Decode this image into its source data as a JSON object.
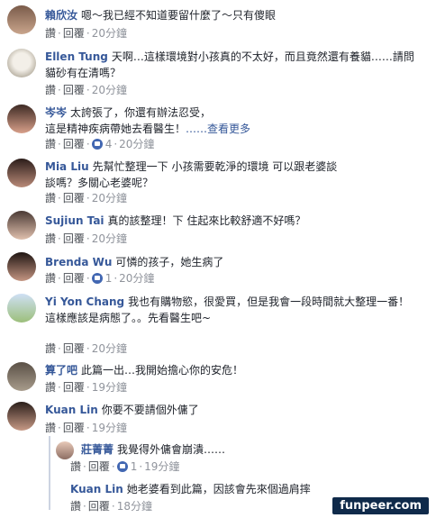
{
  "labels": {
    "reply_action": "讚",
    "reply_link": "回覆",
    "dot": "·"
  },
  "comments": [
    {
      "name": "賴欣汝",
      "text": "嗯～我已經不知道要留什麼了～只有傻眼",
      "time": "20分鐘"
    },
    {
      "name": "Ellen Tung",
      "text": "天啊…這樣環境對小孩真的不太好，而且竟然還有養貓……請問貓砂有在清嗎？",
      "time": "20分鐘"
    },
    {
      "name": "岑岑",
      "text": "太誇張了，你還有辦法忍受，",
      "text2": "這是精神疾病帶她去看醫生！",
      "more": "……查看更多",
      "likes": "4",
      "time": "20分鐘"
    },
    {
      "name": "Mia Liu",
      "text": "先幫忙整理一下 小孩需要乾淨的環境 可以跟老婆談談嗎？多關心老婆呢？",
      "time": "20分鐘"
    },
    {
      "name": "Sujiun Tai",
      "text": "真的該整理！下 住起來比較舒適不好嗎？",
      "time": "20分鐘"
    },
    {
      "name": "Brenda Wu",
      "text": "可憐的孩子，她生病了",
      "likes": "1",
      "time": "20分鐘"
    },
    {
      "name": "Yi Yon Chang",
      "text": "我也有購物慾，很愛買，但是我會一段時間就大整理一番！",
      "text2": "這樣應該是病態了。。先看醫生吧~",
      "time": "20分鐘"
    },
    {
      "name": "算了吧",
      "text": "此篇一出…我開始擔心你的安危！",
      "time": "19分鐘"
    },
    {
      "name": "Kuan Lin",
      "text": "你要不要請個外傭了",
      "time": "19分鐘"
    }
  ],
  "replies": [
    {
      "name": "莊菁菁",
      "text": "我覺得外傭會崩潰……",
      "likes": "1",
      "time": "19分鐘"
    },
    {
      "name": "Kuan Lin",
      "text": "她老婆看到此篇，因該會先來個過肩摔",
      "time": "18分鐘"
    }
  ],
  "watermark": "funpeer.com",
  "colors": {
    "name": "#365899",
    "meta": "#90949c",
    "link": "#4b4f56",
    "like": "#4267b2"
  }
}
